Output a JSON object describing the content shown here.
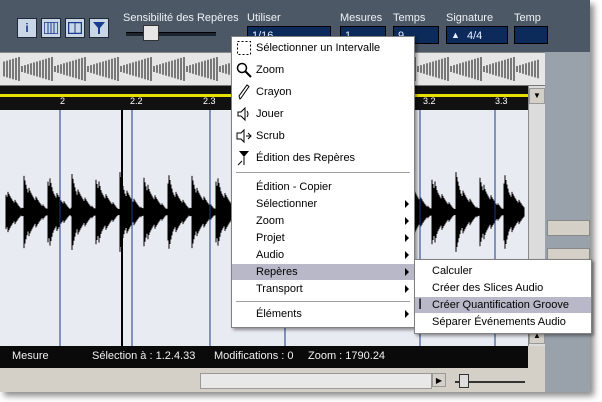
{
  "toolbar": {
    "sensitivity_label": "Sensibilité des Repères",
    "use_label": "Utiliser",
    "use_value": "1/16",
    "measures_label": "Mesures",
    "measures_value": "1",
    "beats_label": "Temps",
    "beats_value": "9",
    "signature_label": "Signature",
    "signature_value": "4/4",
    "tempo_label": "Temp"
  },
  "ruler": {
    "marks": [
      "2",
      "2.2",
      "2.3",
      "3.2",
      "3.3"
    ]
  },
  "context_menu": {
    "items": [
      {
        "label": "Sélectionner un Intervalle",
        "icon": "range-select-icon"
      },
      {
        "label": "Zoom",
        "icon": "magnifier-icon"
      },
      {
        "label": "Crayon",
        "icon": "pencil-icon"
      },
      {
        "label": "Jouer",
        "icon": "speaker-icon"
      },
      {
        "label": "Scrub",
        "icon": "scrub-icon"
      },
      {
        "label": "Édition des Repères",
        "icon": "hitpoint-edit-icon"
      }
    ],
    "edit_copy": "Édition - Copier",
    "submenus": [
      {
        "label": "Sélectionner"
      },
      {
        "label": "Zoom"
      },
      {
        "label": "Projet"
      },
      {
        "label": "Audio"
      },
      {
        "label": "Repères"
      },
      {
        "label": "Transport"
      }
    ],
    "elements": "Éléments"
  },
  "submenu": {
    "items": [
      "Calculer",
      "Créer des Slices Audio",
      "Créer Quantification Groove",
      "Séparer Événements Audio"
    ]
  },
  "status": {
    "mode": "Mesure",
    "selection": "Sélection à : 1.2.4.33",
    "modifications": "Modifications : 0",
    "zoom": "Zoom : 1790.24"
  },
  "colors": {
    "toolbar_bg": "#4c5866",
    "field_bg": "#0c2a5a",
    "ruler_line": "#e8e000",
    "hitpoint_line": "#1d3a8a",
    "menu_highlight": "#b8b8c8"
  }
}
